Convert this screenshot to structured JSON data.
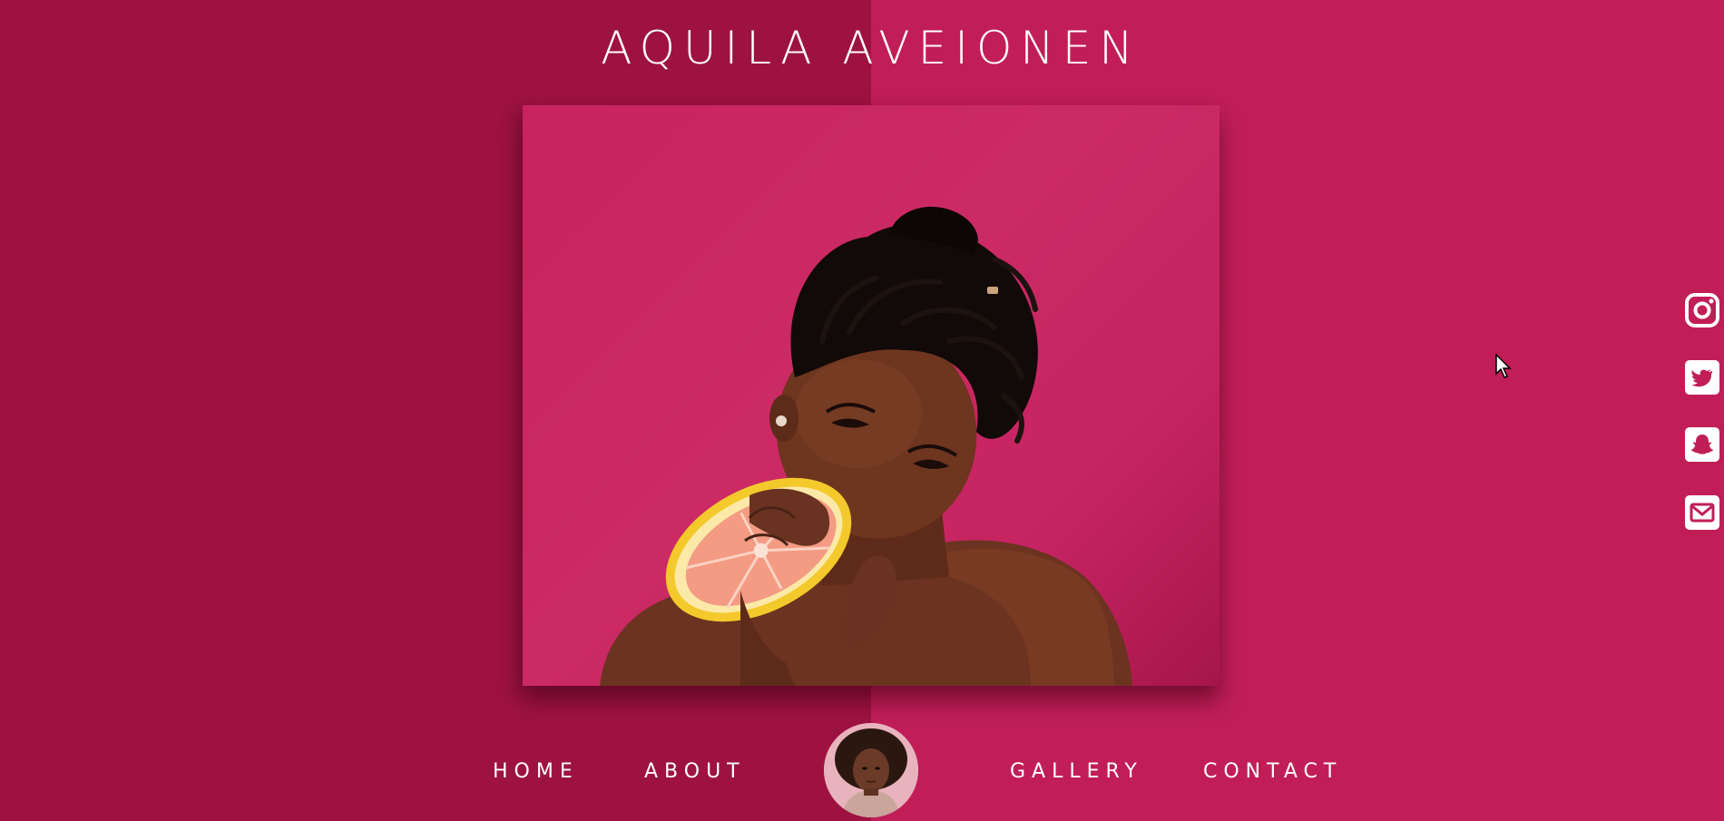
{
  "site": {
    "title": "AQUILA AVEIONEN"
  },
  "nav": {
    "items": [
      {
        "label": "HOME"
      },
      {
        "label": "ABOUT"
      },
      {
        "label": "GALLERY"
      },
      {
        "label": "CONTACT"
      }
    ]
  },
  "social": {
    "icons": [
      "instagram-icon",
      "twitter-icon",
      "snapchat-icon",
      "email-icon"
    ]
  },
  "colors": {
    "background_left": "#9e1242",
    "background_right": "#c11e58",
    "text": "#ffffff",
    "photo_backdrop": "#cc2a64"
  }
}
